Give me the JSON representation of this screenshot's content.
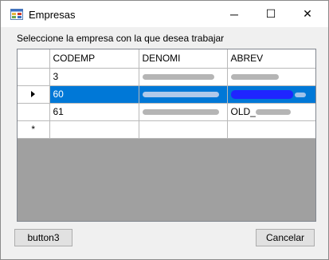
{
  "window": {
    "title": "Empresas",
    "icon": "window-app-icon",
    "controls": {
      "minimize": "─",
      "maximize": "☐",
      "close": "✕"
    }
  },
  "prompt": "Seleccione la empresa con la que desea trabajar",
  "grid": {
    "columns": [
      "CODEMP",
      "DENOMI",
      "ABREV"
    ],
    "rows": [
      {
        "codemp": "3",
        "denomi": "",
        "abrev": "",
        "selected": false
      },
      {
        "codemp": "60",
        "denomi": "",
        "abrev": "",
        "selected": true
      },
      {
        "codemp": "61",
        "denomi": "",
        "abrev": "OLD_",
        "selected": false
      }
    ],
    "selected_marker": "▶",
    "new_row_marker": "*",
    "colors": {
      "selection": "#0078d7",
      "empty_area": "#a0a0a0"
    }
  },
  "buttons": {
    "left": "button3",
    "right": "Cancelar"
  }
}
